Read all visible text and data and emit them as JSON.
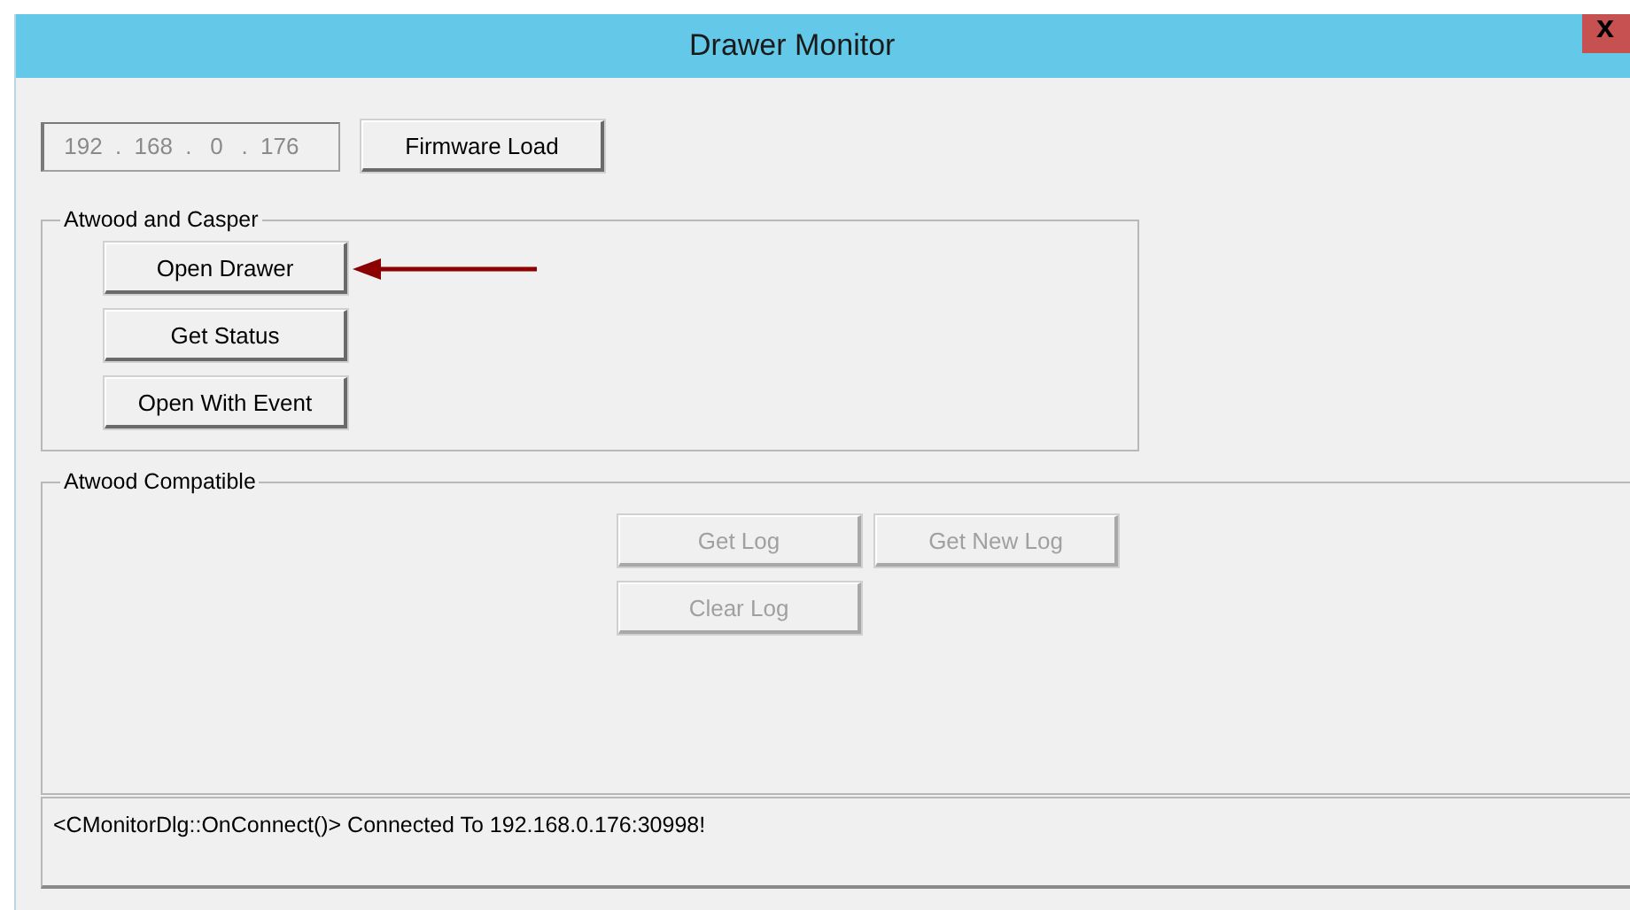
{
  "window": {
    "title": "Drawer Monitor",
    "close": "x"
  },
  "ip_address": {
    "octets": [
      "192",
      "168",
      "0",
      "176"
    ],
    "separator": ".",
    "disabled": true
  },
  "firmware_button": {
    "label": "Firmware Load",
    "disabled": false
  },
  "groups": [
    {
      "title": "Atwood and Casper",
      "kind": "column",
      "buttons": [
        {
          "label": "Open Drawer",
          "disabled": false,
          "annotated": true
        },
        {
          "label": "Get Status",
          "disabled": false,
          "annotated": false
        },
        {
          "label": "Open With Event",
          "disabled": false,
          "annotated": false
        }
      ]
    },
    {
      "title": "Atwood Compatible",
      "kind": "grid",
      "buttons": [
        {
          "label": "Get Log",
          "disabled": true,
          "annotated": false
        },
        {
          "label": "Get New Log",
          "disabled": true,
          "annotated": false
        },
        {
          "label": "Clear Log",
          "disabled": true,
          "annotated": false
        }
      ]
    }
  ],
  "status": {
    "message": "<CMonitorDlg::OnConnect()> Connected To 192.168.0.176:30998!"
  }
}
